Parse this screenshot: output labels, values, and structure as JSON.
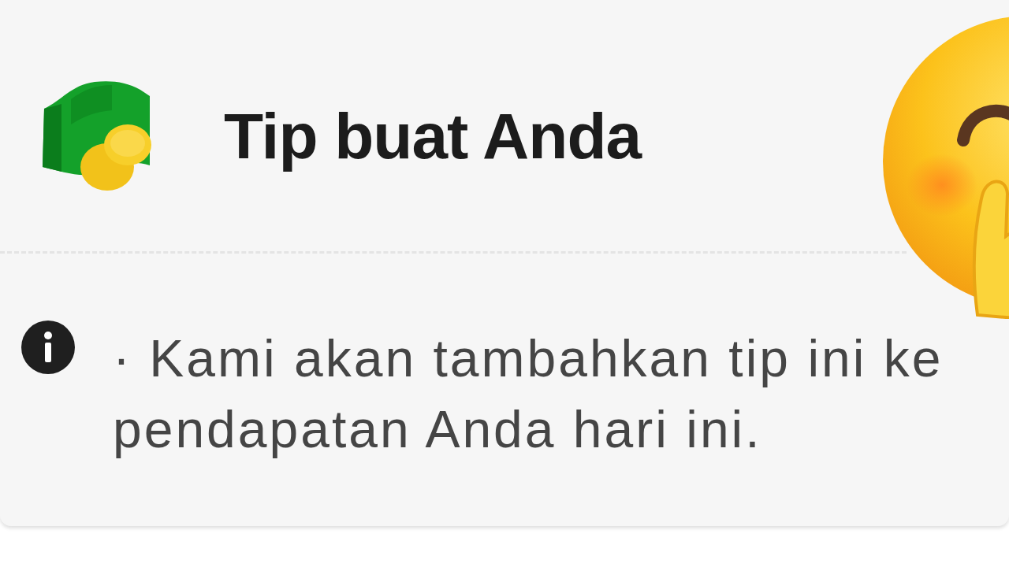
{
  "card": {
    "title": "Tip buat Anda",
    "note": "· Kami akan tambahkan tip ini ke pendapatan Anda hari ini."
  }
}
